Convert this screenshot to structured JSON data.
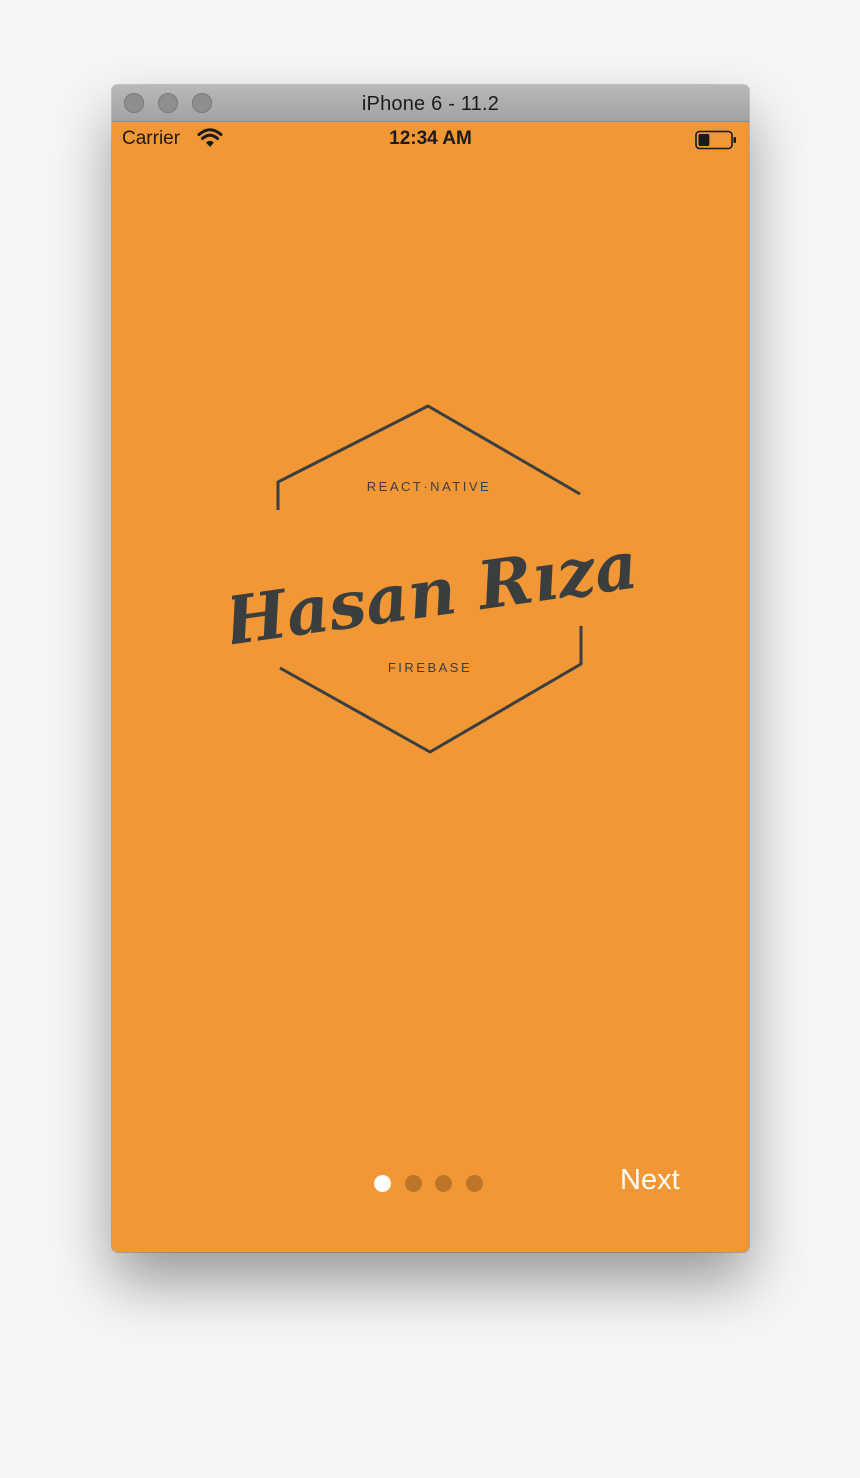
{
  "window": {
    "title": "iPhone 6 - 11.2"
  },
  "status_bar": {
    "carrier": "Carrier",
    "time": "12:34 AM",
    "wifi_icon": "wifi-icon",
    "battery_icon": "battery-icon",
    "battery_level": 0.35
  },
  "logo": {
    "top_text": "REACT·NATIVE",
    "name": "Hasan Rıza",
    "bottom_text": "FIREBASE"
  },
  "pager": {
    "total": 4,
    "active_index": 0
  },
  "actions": {
    "next_label": "Next"
  },
  "colors": {
    "background": "#f29736",
    "logo_ink": "#3b3e3f",
    "active_dot": "#ffffff"
  }
}
